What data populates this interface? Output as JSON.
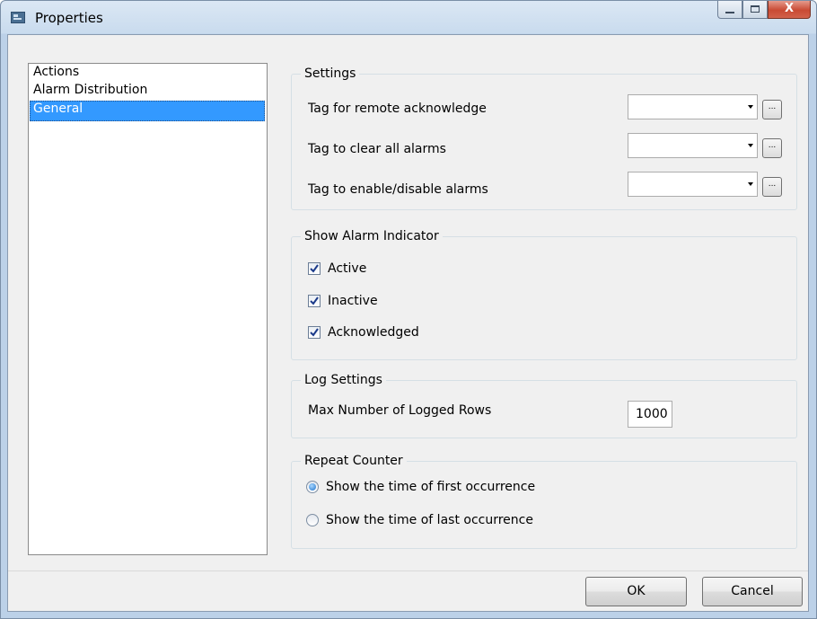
{
  "window": {
    "title": "Properties",
    "minimize_label": "",
    "maximize_label": "",
    "close_label": "X"
  },
  "nav": {
    "items": [
      {
        "label": "Actions"
      },
      {
        "label": "Alarm Distribution"
      },
      {
        "label": "General"
      }
    ],
    "selected": "General"
  },
  "settings": {
    "legend": "Settings",
    "rows": [
      {
        "label": "Tag for remote acknowledge",
        "value": "",
        "browse_label": "..."
      },
      {
        "label": "Tag to clear all alarms",
        "value": "",
        "browse_label": "..."
      },
      {
        "label": "Tag to enable/disable alarms",
        "value": "",
        "browse_label": "..."
      }
    ]
  },
  "alarm_indicator": {
    "legend": "Show Alarm Indicator",
    "options": [
      {
        "label": "Active",
        "checked": true
      },
      {
        "label": "Inactive",
        "checked": true
      },
      {
        "label": "Acknowledged",
        "checked": true
      }
    ]
  },
  "log_settings": {
    "legend": "Log Settings",
    "max_rows_label": "Max Number of Logged Rows",
    "max_rows_value": "1000"
  },
  "repeat_counter": {
    "legend": "Repeat Counter",
    "options": [
      {
        "label": "Show the time of first occurrence",
        "selected": true
      },
      {
        "label": "Show the time of last occurrence",
        "selected": false
      }
    ]
  },
  "footer": {
    "ok_label": "OK",
    "cancel_label": "Cancel"
  },
  "colors": {
    "selection": "#3399ff",
    "dialog_background": "#f0f0f0",
    "close_button": "#c94a34"
  }
}
